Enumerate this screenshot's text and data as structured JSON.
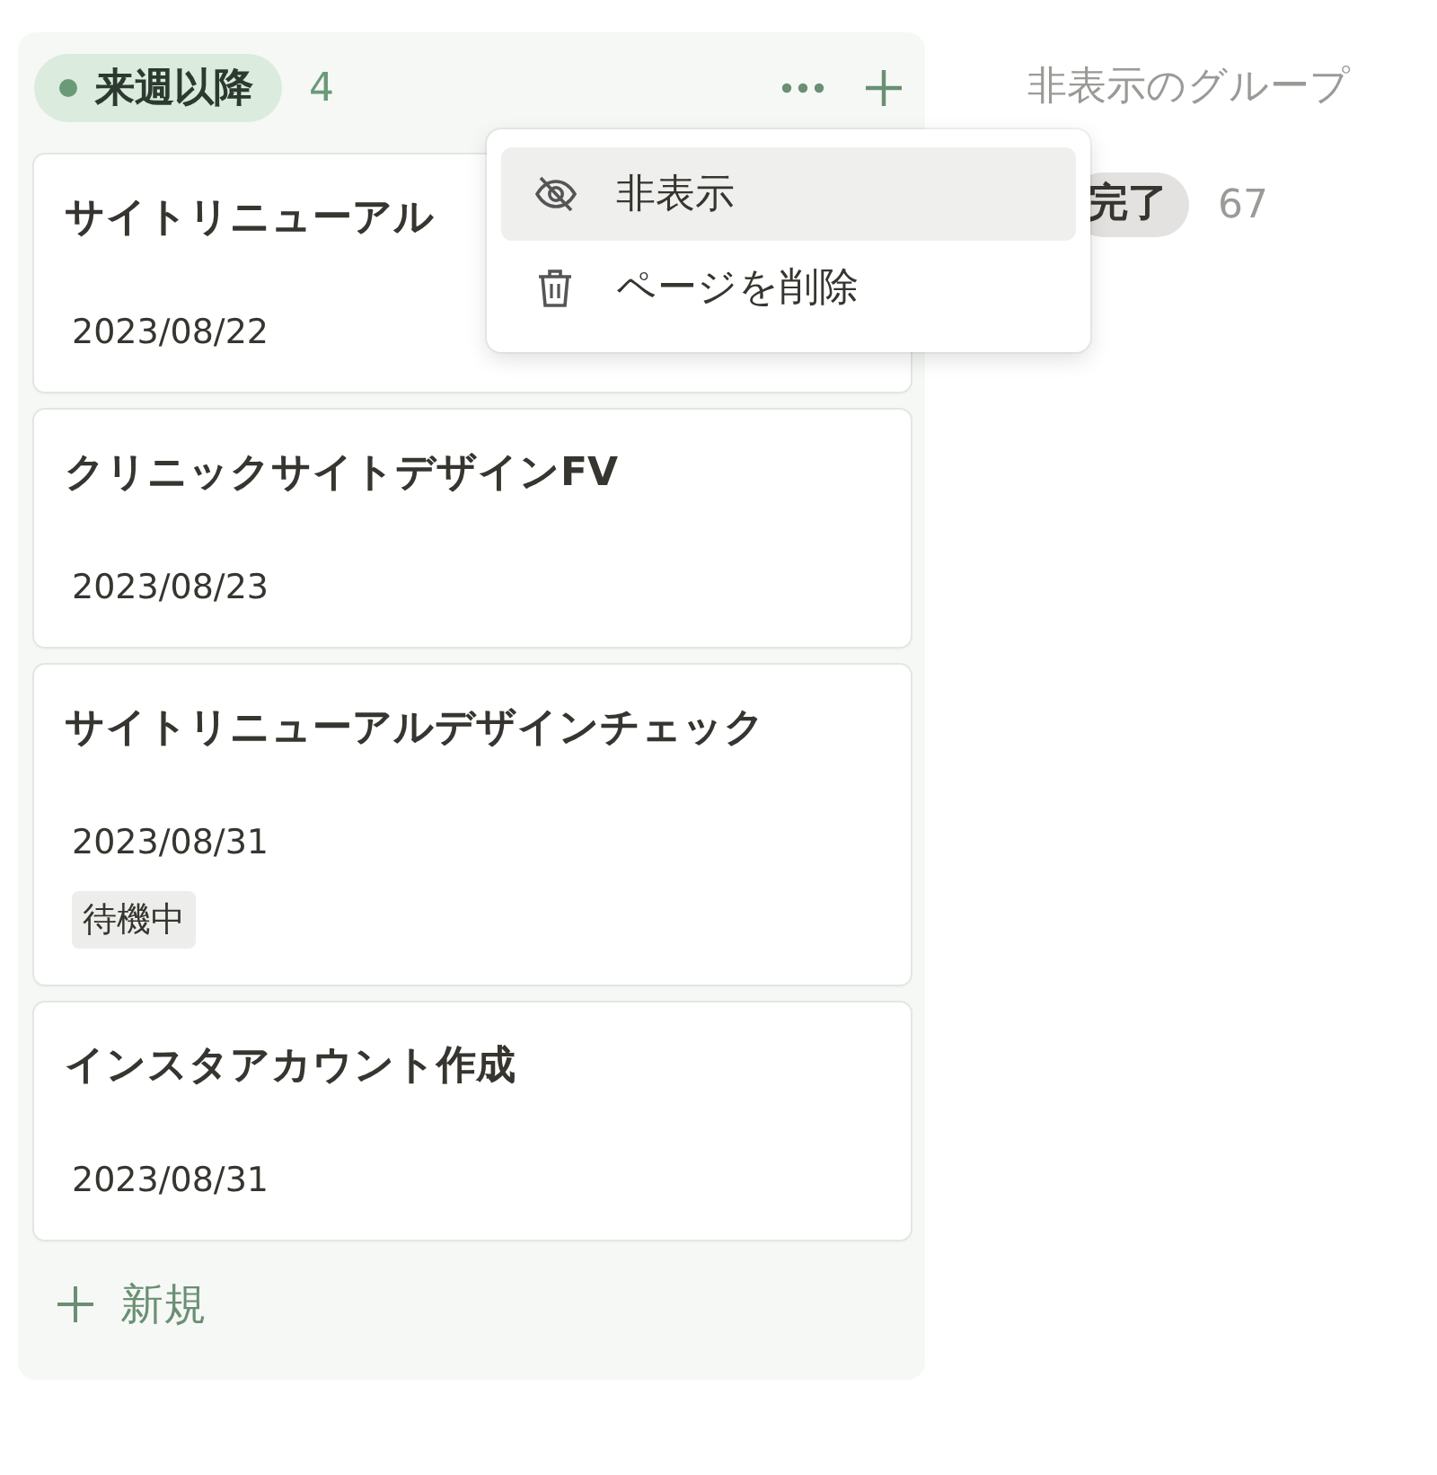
{
  "column": {
    "label": "来週以降",
    "count": "4",
    "cards": [
      {
        "title": "サイトリニューアル",
        "date": "2023/08/22"
      },
      {
        "title": "クリニックサイトデザインFV",
        "date": "2023/08/23"
      },
      {
        "title": "サイトリニューアルデザインチェック",
        "date": "2023/08/31",
        "tags": [
          "待機中"
        ]
      },
      {
        "title": "インスタアカウント作成",
        "date": "2023/08/31"
      }
    ],
    "new_label": "新規"
  },
  "hidden_groups": {
    "title": "非表示のグループ",
    "groups": [
      {
        "label": "完了",
        "count": "67"
      }
    ]
  },
  "menu": {
    "items": [
      {
        "kind": "hide",
        "label": "非表示",
        "selected": true
      },
      {
        "kind": "delete",
        "label": "ページを削除",
        "selected": false
      }
    ]
  }
}
